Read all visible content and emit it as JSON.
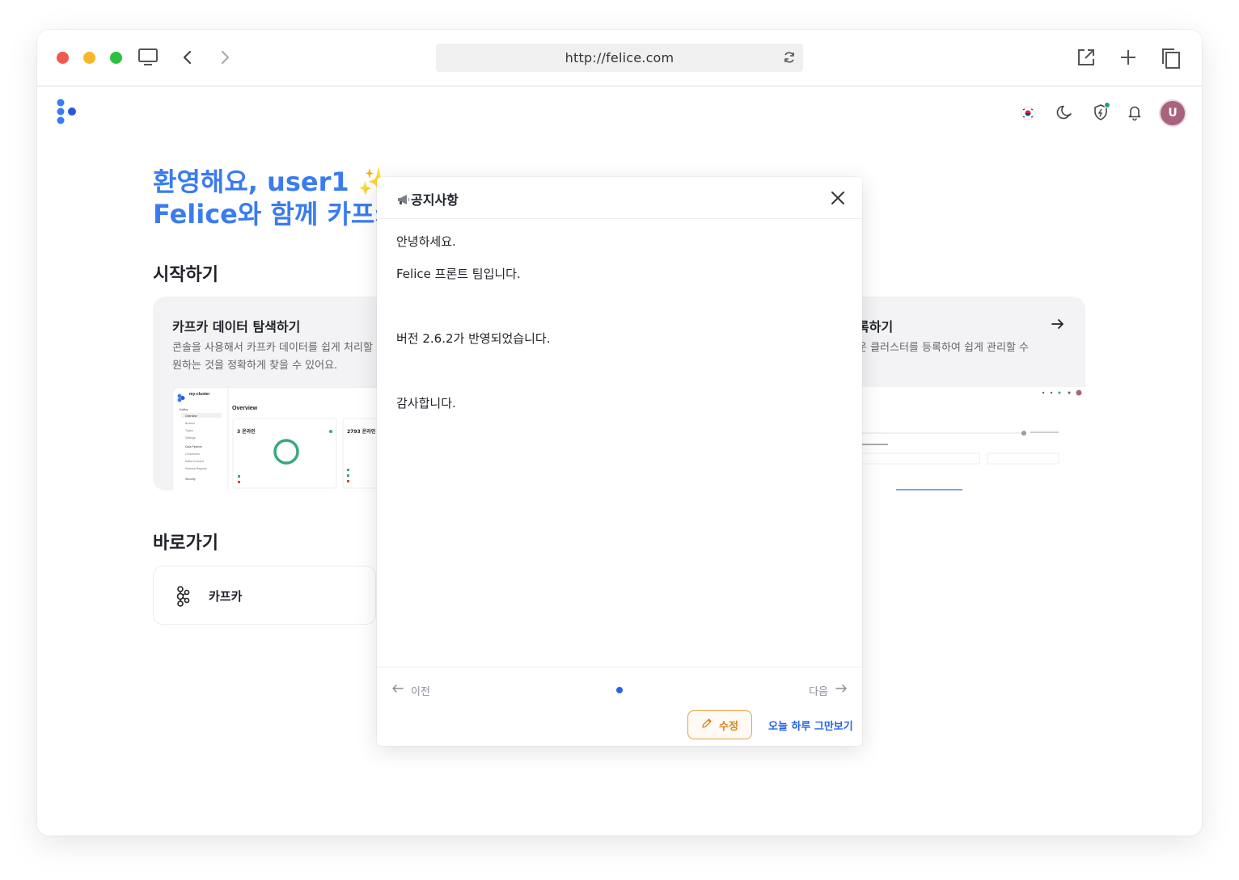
{
  "browser": {
    "url": "http://felice.com"
  },
  "header": {
    "avatar_initial": "U",
    "icons": [
      "korea-flag-icon",
      "moon-icon",
      "shield-icon",
      "bell-icon"
    ],
    "status_color": "#1fa574"
  },
  "welcome": {
    "line1": "환영해요, user1 ✨",
    "line2": "Felice와 함께 카프카"
  },
  "sections": {
    "getting_started": "시작하기",
    "shortcuts": "바로가기"
  },
  "cards": [
    {
      "title": "카프카 데이터 탐색하기",
      "desc_line1": "콘솔을 사용해서 카프카 데이터를 쉽게 처리할",
      "desc_line2": "원하는 것을 정확하게 찾을 수 있어요."
    },
    {
      "title": "록하기",
      "desc_line1": "운 클러스터를 등록하여 쉽게 관리할 수"
    }
  ],
  "preview": {
    "cluster_name": "my-cluster",
    "overview": "Overview",
    "stat1": "3 온라인",
    "stat2": "2793 온라인",
    "menu": [
      "Kafka",
      "Overview",
      "Brokers",
      "Topics",
      "Settings",
      "Data Pipeline",
      "Connectors",
      "Kafka Connect",
      "Schema Registry",
      "Security"
    ]
  },
  "shortcut": {
    "label": "카프카"
  },
  "modal": {
    "title": "공지사항",
    "body": [
      "안녕하세요.",
      "Felice 프론트 팀입니다.",
      "",
      "버전 2.6.2가 반영되었습니다.",
      "",
      "감사합니다."
    ],
    "prev_label": "이전",
    "next_label": "다음",
    "edit_label": "수정",
    "dismiss_label": "오늘 하루 그만보기"
  },
  "colors": {
    "accent": "#3a7cf0",
    "primary": "#2563eb",
    "edit": "#e8a04a",
    "avatar": "#a8637e"
  }
}
